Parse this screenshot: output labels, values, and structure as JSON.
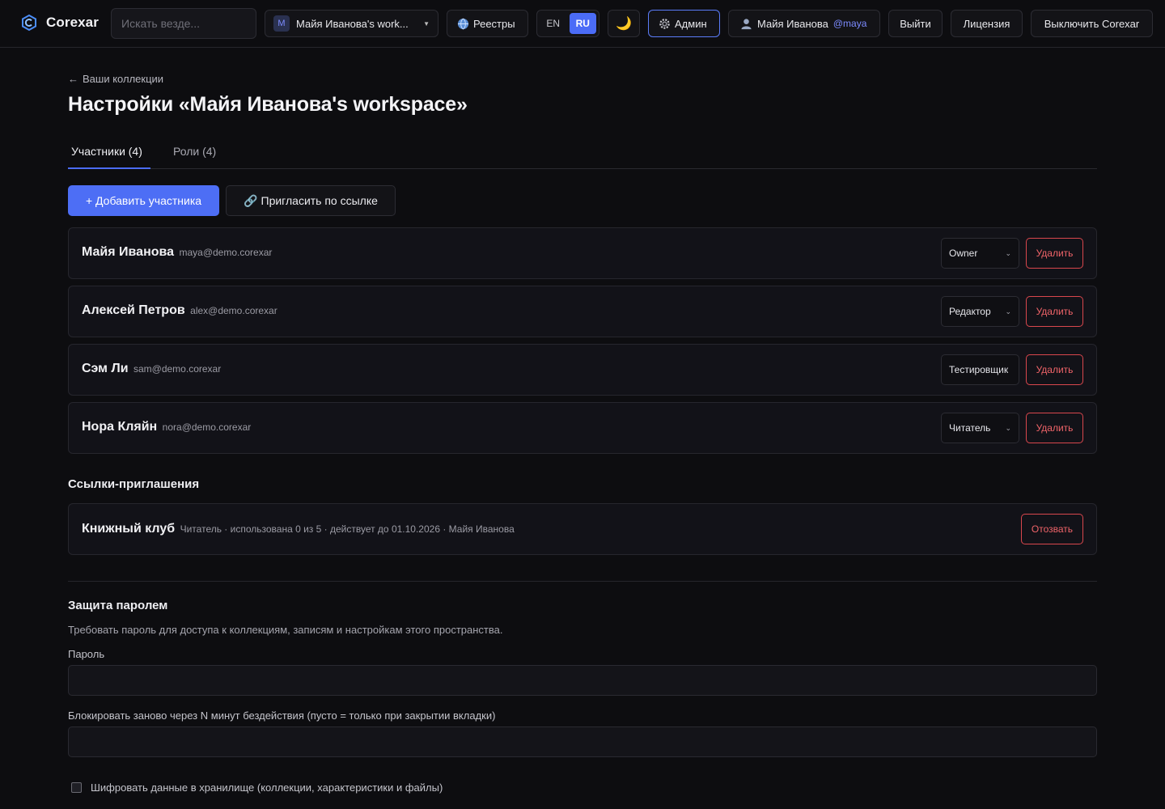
{
  "app": {
    "name": "Corexar",
    "search_placeholder": "Искать везде...",
    "workspace": {
      "badge": "M",
      "name": "Майя Иванова's work..."
    },
    "registries_label": "Реестры",
    "lang": {
      "en": "EN",
      "ru": "RU",
      "active": "RU"
    },
    "theme_icon": "🌙",
    "admin_label": "Админ",
    "user": {
      "name": "Майя Иванова",
      "handle": "@maya"
    },
    "logout_label": "Выйти",
    "license_label": "Лицензия",
    "shutdown_label": "Выключить Corexar",
    "accent": "#4d6ef5",
    "danger": "#d9474d"
  },
  "page": {
    "back_label": "Ваши коллекции",
    "title": "Настройки «Майя Иванова's workspace»",
    "tabs": [
      {
        "label": "Участники (4)",
        "active": true
      },
      {
        "label": "Роли (4)",
        "active": false
      }
    ],
    "add_member_label": "+ Добавить участника",
    "invite_link_label": "Пригласить по ссылке"
  },
  "members": [
    {
      "name": "Майя Иванова",
      "email": "maya@demo.corexar",
      "role": "Owner",
      "dropdown": true,
      "delete_label": "Удалить"
    },
    {
      "name": "Алексей Петров",
      "email": "alex@demo.corexar",
      "role": "Редактор",
      "dropdown": true,
      "delete_label": "Удалить"
    },
    {
      "name": "Сэм Ли",
      "email": "sam@demo.corexar",
      "role": "Тестировщик",
      "dropdown": false,
      "delete_label": "Удалить"
    },
    {
      "name": "Нора Кляйн",
      "email": "nora@demo.corexar",
      "role": "Читатель",
      "dropdown": true,
      "delete_label": "Удалить"
    }
  ],
  "invites": {
    "title": "Ссылки-приглашения",
    "items": [
      {
        "name": "Книжный клуб",
        "meta": "Читатель · использована 0 из 5 · действует до 01.10.2026 · Майя Иванова",
        "revoke_label": "Отозвать"
      }
    ]
  },
  "password": {
    "title": "Защита паролем",
    "description": "Требовать пароль для доступа к коллекциям, записям и настройкам этого пространства.",
    "password_label": "Пароль",
    "password_value": "",
    "relock_label": "Блокировать заново через N минут бездействия (пусто = только при закрытии вкладки)",
    "relock_value": "",
    "encrypt_label": "Шифровать данные в хранилище (коллекции, характеристики и файлы)",
    "encrypt_checked": false
  }
}
